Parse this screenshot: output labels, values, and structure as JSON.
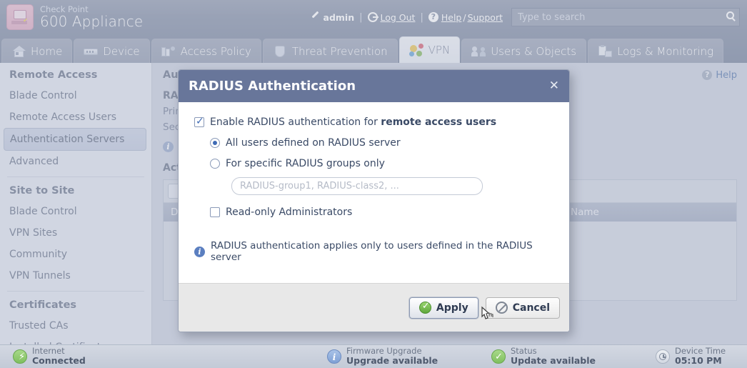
{
  "header": {
    "brand_top": "Check Point",
    "brand_main": "600 Appliance",
    "logo_icon": "checkpoint-monitor-logo",
    "admin_label": "admin",
    "pencil_icon": "pencil-icon",
    "sep1": "|",
    "logout_icon": "power-icon",
    "logout_label": "Log Out",
    "sep2": "|",
    "help_icon": "question-icon",
    "help_label": "Help",
    "help_slash": "/",
    "support_label": "Support",
    "search": {
      "placeholder": "Type to search",
      "value": "",
      "icon": "search-icon"
    }
  },
  "tabs": [
    {
      "label": "Home",
      "icon": "home-icon",
      "active": false
    },
    {
      "label": "Device",
      "icon": "device-icon",
      "active": false
    },
    {
      "label": "Access Policy",
      "icon": "access-policy-icon",
      "active": false
    },
    {
      "label": "Threat Prevention",
      "icon": "shield-icon",
      "active": false
    },
    {
      "label": "VPN",
      "icon": "vpn-icon",
      "active": true
    },
    {
      "label": "Users & Objects",
      "icon": "users-icon",
      "active": false
    },
    {
      "label": "Logs & Monitoring",
      "icon": "logs-icon",
      "active": false
    }
  ],
  "sidebar": {
    "groups": [
      {
        "title": "Remote Access",
        "items": [
          {
            "label": "Blade Control",
            "active": false
          },
          {
            "label": "Remote Access Users",
            "active": false
          },
          {
            "label": "Authentication Servers",
            "active": true
          },
          {
            "label": "Advanced",
            "active": false
          }
        ]
      },
      {
        "title": "Site to Site",
        "items": [
          {
            "label": "Blade Control",
            "active": false
          },
          {
            "label": "VPN Sites",
            "active": false
          },
          {
            "label": "Community",
            "active": false
          },
          {
            "label": "VPN Tunnels",
            "active": false
          }
        ]
      },
      {
        "title": "Certificates",
        "items": [
          {
            "label": "Trusted CAs",
            "active": false
          },
          {
            "label": "Installed Certificates",
            "active": false
          }
        ]
      }
    ]
  },
  "content": {
    "page_title": "Authentication Servers Definition",
    "help_label": "Help",
    "help_icon": "question-icon",
    "section_radius": "RADIUS",
    "primary_label": "Primary",
    "secondary_label": "Secondary",
    "info_icon": "info-icon",
    "section_active": "Active Directory",
    "table": {
      "add_button_icon": "add-icon",
      "columns": [
        "Domain",
        "Name"
      ]
    }
  },
  "modal": {
    "title": "RADIUS Authentication",
    "close_icon": "close-icon",
    "enable_checkbox": {
      "checked": true,
      "text_prefix": "Enable RADIUS authentication for ",
      "text_bold": "remote access users"
    },
    "radio_all": {
      "label": "All users defined on RADIUS server",
      "selected": true
    },
    "radio_groups": {
      "label": "For specific RADIUS groups only",
      "selected": false
    },
    "groups_input": {
      "placeholder": "RADIUS-group1, RADIUS-class2, ...",
      "value": ""
    },
    "readonly_checkbox": {
      "checked": false,
      "label": "Read-only Administrators"
    },
    "note": {
      "icon": "info-icon",
      "text": "RADIUS authentication applies only to users defined in the RADIUS server"
    },
    "apply_button": {
      "label": "Apply",
      "icon": "check-circle-icon",
      "hovered": true
    },
    "cancel_button": {
      "label": "Cancel",
      "icon": "no-entry-icon"
    }
  },
  "statusbar": [
    {
      "icon": "internet-bolt-icon",
      "label": "Internet",
      "value": "Connected",
      "tone": "green"
    },
    {
      "icon": "info-icon",
      "label": "Firmware Upgrade",
      "value": "Upgrade available",
      "tone": "blue"
    },
    {
      "icon": "check-icon",
      "label": "Status",
      "value": "Update available",
      "tone": "green"
    },
    {
      "icon": "clock-icon",
      "label": "Device Time",
      "value": "05:10 PM",
      "tone": "gray"
    }
  ],
  "colors": {
    "header_bg": "#7e8aa2",
    "tab_active_bg": "#eef1f6",
    "modal_title_bg": "#68769a",
    "accent_blue": "#3e6bb5",
    "status_green": "#7fbf5e"
  }
}
